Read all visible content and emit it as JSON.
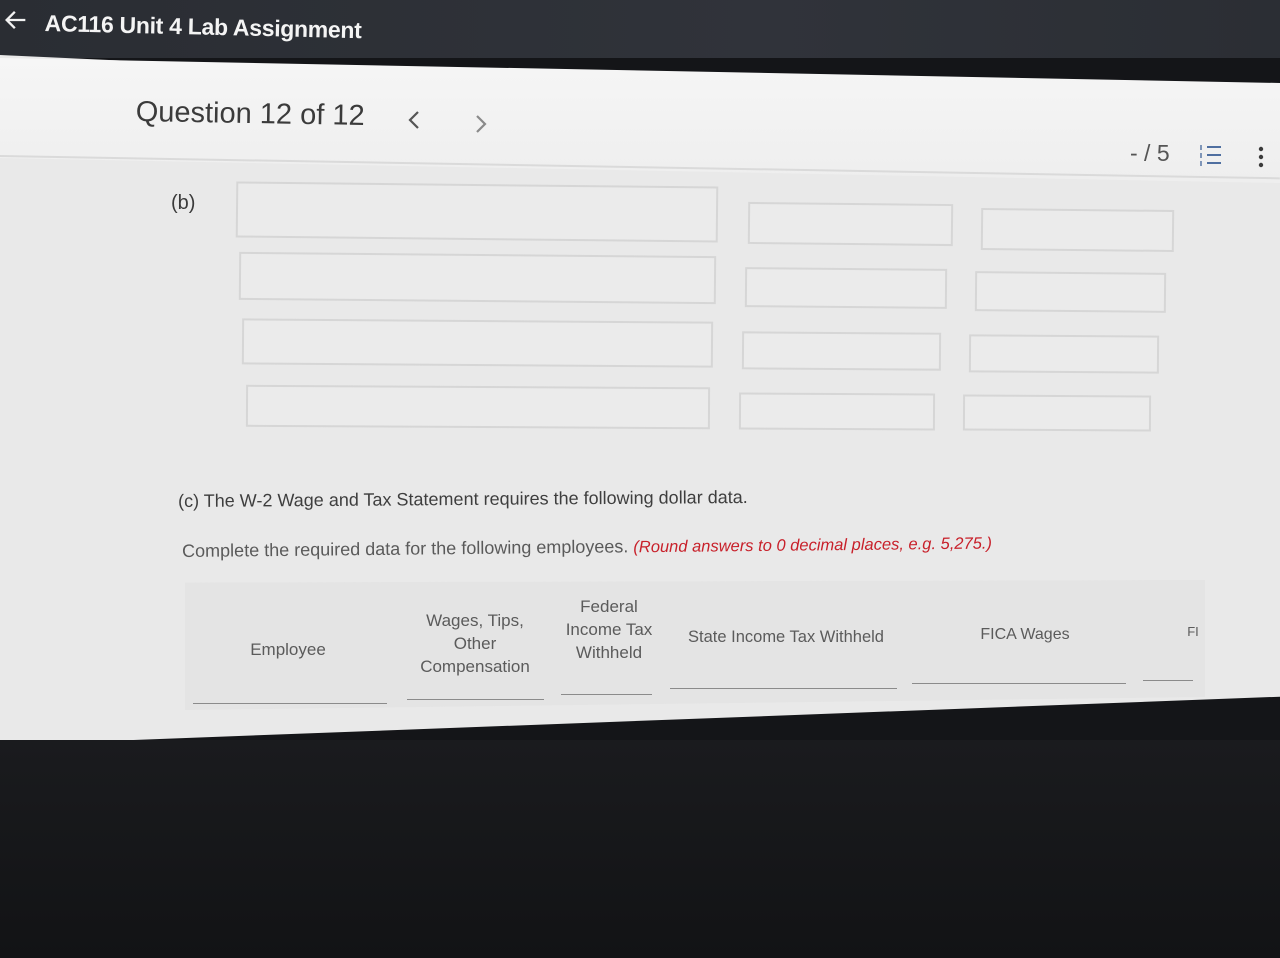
{
  "app": {
    "title": "AC116 Unit 4 Lab Assignment"
  },
  "question": {
    "title": "Question 12 of 12",
    "prev_icon": "chevron-left-icon",
    "next_icon": "chevron-right-icon",
    "score": "- / 5"
  },
  "part_b": {
    "label": "(b)",
    "rows": [
      {
        "col1": "",
        "col2": "",
        "col3": ""
      },
      {
        "col1": "",
        "col2": "",
        "col3": ""
      },
      {
        "col1": "",
        "col2": "",
        "col3": ""
      },
      {
        "col1": "",
        "col2": "",
        "col3": ""
      }
    ]
  },
  "part_c": {
    "text": "(c) The W-2 Wage and Tax Statement requires the following dollar data.",
    "instructions": "Complete the required data for the following employees.",
    "hint": "(Round answers to 0 decimal places, e.g. 5,275.)"
  },
  "table": {
    "headers": [
      "Employee",
      "Wages, Tips, Other Compensation",
      "Federal Income Tax Withheld",
      "State Income Tax Withheld",
      "FICA Wages",
      "FI"
    ]
  }
}
